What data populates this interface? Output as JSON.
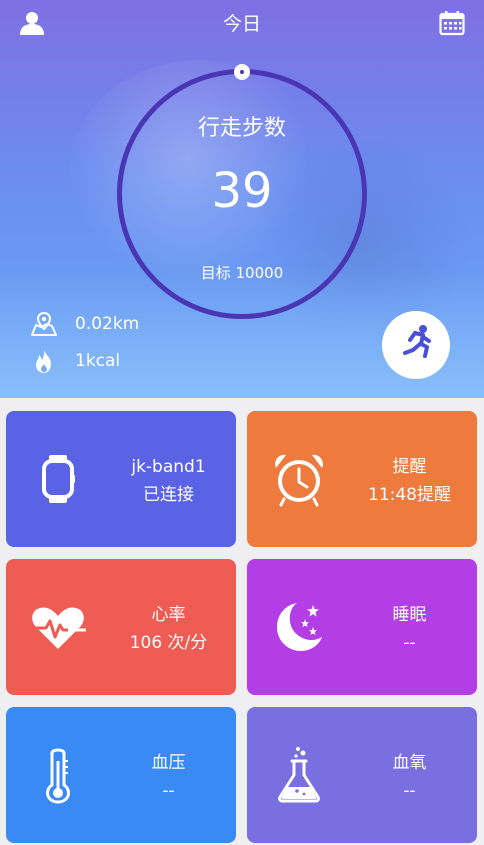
{
  "header": {
    "title": "今日"
  },
  "steps": {
    "label": "行走步数",
    "value": "39",
    "goal": "目标 10000"
  },
  "stats": {
    "distance": "0.02km",
    "calories": "1kcal"
  },
  "cards": [
    {
      "title": "jk-band1",
      "value": "已连接",
      "color": "#5a62e6"
    },
    {
      "title": "提醒",
      "value": "11:48提醒",
      "color": "#ef7a3d"
    },
    {
      "title": "心率",
      "value": "106 次/分",
      "color": "#ef5c54"
    },
    {
      "title": "睡眠",
      "value": "--",
      "color": "#b33ee6"
    },
    {
      "title": "血压",
      "value": "--",
      "color": "#3a8af5"
    },
    {
      "title": "血氧",
      "value": "--",
      "color": "#7a6fe0"
    }
  ],
  "icons": {
    "profile": "user-icon",
    "calendar": "calendar-icon",
    "distance": "map-pin-icon",
    "calories": "flame-icon",
    "run": "running-icon",
    "band": "watch-icon",
    "alarm": "alarm-clock-icon",
    "heart": "heart-rate-icon",
    "sleep": "moon-stars-icon",
    "pressure": "thermometer-icon",
    "oxygen": "flask-icon"
  }
}
